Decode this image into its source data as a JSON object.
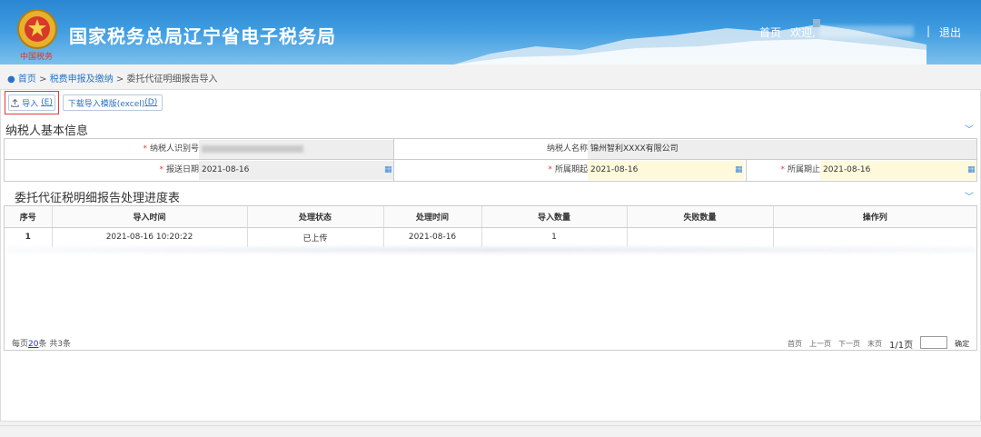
{
  "header": {
    "emblem_text": "中国税务",
    "site_title": "国家税务总局辽宁省电子税务局",
    "home_link": "首页",
    "welcome": "欢迎,",
    "separator": "|",
    "logout": "退出"
  },
  "breadcrumb": {
    "home": "首页",
    "sep1": ">",
    "level1": "税费申报及缴纳",
    "sep2": ">",
    "current": "委托代征明细报告导入"
  },
  "toolbar": {
    "import_label": "导入",
    "import_hotkey": "(E)",
    "template_label": "下载导入模版(excel)",
    "template_hotkey": "(D)"
  },
  "section1": {
    "title": "纳税人基本信息"
  },
  "form": {
    "taxpayer_id_label": "纳税人识别号",
    "taxpayer_name_label": "纳税人名称",
    "taxpayer_name_value": "锦州智利XXXX有限公司",
    "report_date_label": "报送日期",
    "report_date_value": "2021-08-16",
    "period_start_label": "所属期起",
    "period_start_value": "2021-08-16",
    "period_end_label": "所属期止",
    "period_end_value": "2021-08-16",
    "required_mark": "*"
  },
  "section2": {
    "title": "委托代征税明细报告处理进度表"
  },
  "grid": {
    "headers": [
      "序号",
      "导入时间",
      "处理状态",
      "处理时间",
      "导入数量",
      "失败数量",
      "操作列"
    ],
    "rows": [
      [
        "1",
        "2021-08-16 10:20:22",
        "已上传",
        "2021-08-16",
        "1",
        "",
        ""
      ]
    ]
  },
  "pager": {
    "per_page_prefix": "每页",
    "per_page_value": "20",
    "per_page_suffix": "条 共3条",
    "first": "首页",
    "prev": "上一页",
    "next": "下一页",
    "last": "末页",
    "page_info": "1/1页",
    "go": "确定"
  },
  "colors": {
    "header_blue": "#2a86d2",
    "link_blue": "#2a73c3",
    "highlight_red": "#e23a3a",
    "field_yellow": "#fff9dc"
  }
}
